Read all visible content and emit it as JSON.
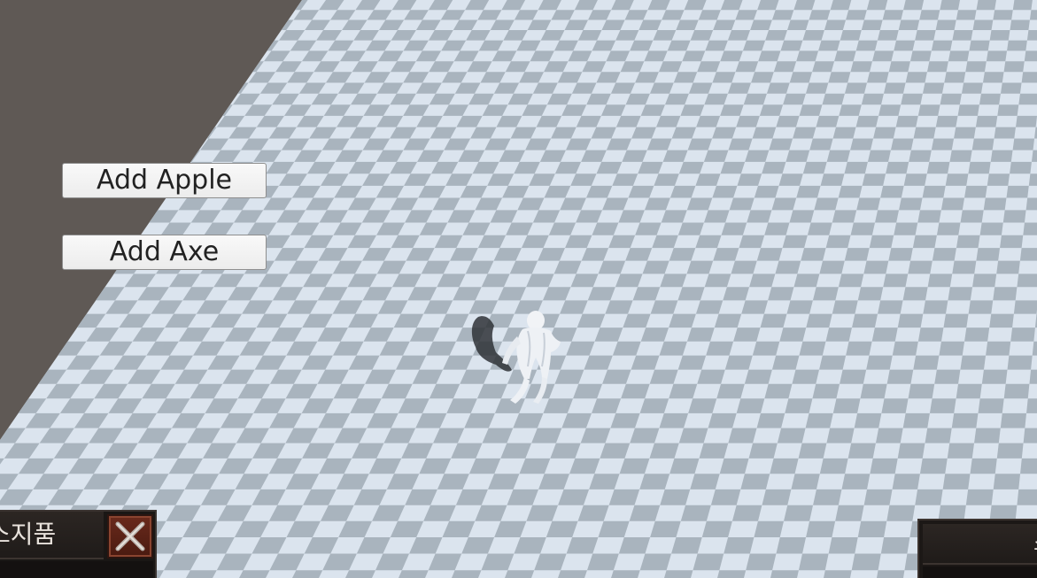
{
  "scene": {
    "sky_color": "#5f5955",
    "checker_light": "#dbe4ee",
    "checker_dark": "#a9b4be",
    "character": "white-humanoid-character"
  },
  "buttons": {
    "add_apple": "Add Apple",
    "add_axe": "Add Axe"
  },
  "inventory_left": {
    "title": "소지품",
    "close_icon": "close-x-icon"
  },
  "inventory_right": {
    "title": "소"
  }
}
